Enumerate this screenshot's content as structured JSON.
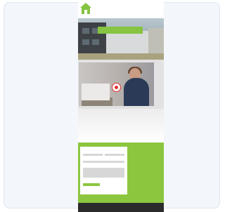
{
  "header": {
    "logo_text": "",
    "nav": [
      "",
      ""
    ]
  },
  "hero": {
    "banner_text": "",
    "subtitle": ""
  },
  "video": {
    "play_icon": "play-icon"
  },
  "contact_form": {
    "fields": [
      "",
      "",
      "",
      ""
    ],
    "submit_label": "",
    "link_text": ""
  },
  "footer_side": {
    "heading": "",
    "lines": [
      "",
      "",
      "",
      "",
      ""
    ]
  },
  "bottom_bar": {
    "links": [
      "",
      ""
    ]
  },
  "colors": {
    "accent_green": "#8cc63f",
    "play_red": "#e12f2f",
    "bottom_bar": "#2b2b2b"
  }
}
